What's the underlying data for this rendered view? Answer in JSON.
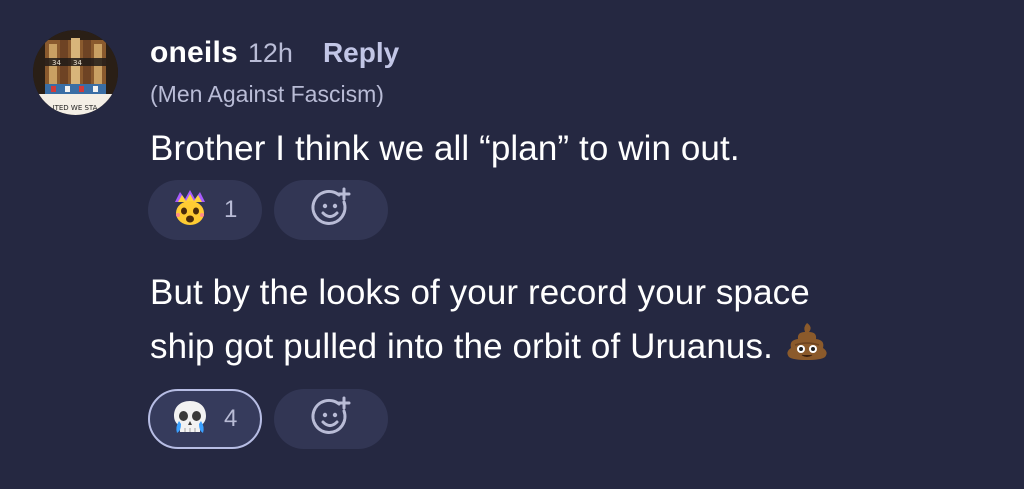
{
  "comment": {
    "username": "oneils",
    "timestamp": "12h",
    "reply_label": "Reply",
    "flair": "(Men Against Fascism)",
    "avatar_text": "ITED WE STA",
    "messages": [
      {
        "text": "Brother I think we all “plan” to win out.",
        "reactions": [
          {
            "emoji": "exploding-head-crown-emoji",
            "count": "1",
            "selected": false
          }
        ]
      },
      {
        "lines": [
          "But by the looks of your record your space",
          "ship got pulled into the orbit of Uruanus."
        ],
        "trailing_emoji": "pile-of-poo-emoji",
        "reactions": [
          {
            "emoji": "skull-crying-emoji",
            "count": "4",
            "selected": true
          }
        ]
      }
    ],
    "add_reaction_icon": "add-emoji-icon"
  },
  "colors": {
    "background": "#252841",
    "pill": "#323654",
    "selected_border": "#b7bde4",
    "muted_text": "#b9bcd6"
  }
}
